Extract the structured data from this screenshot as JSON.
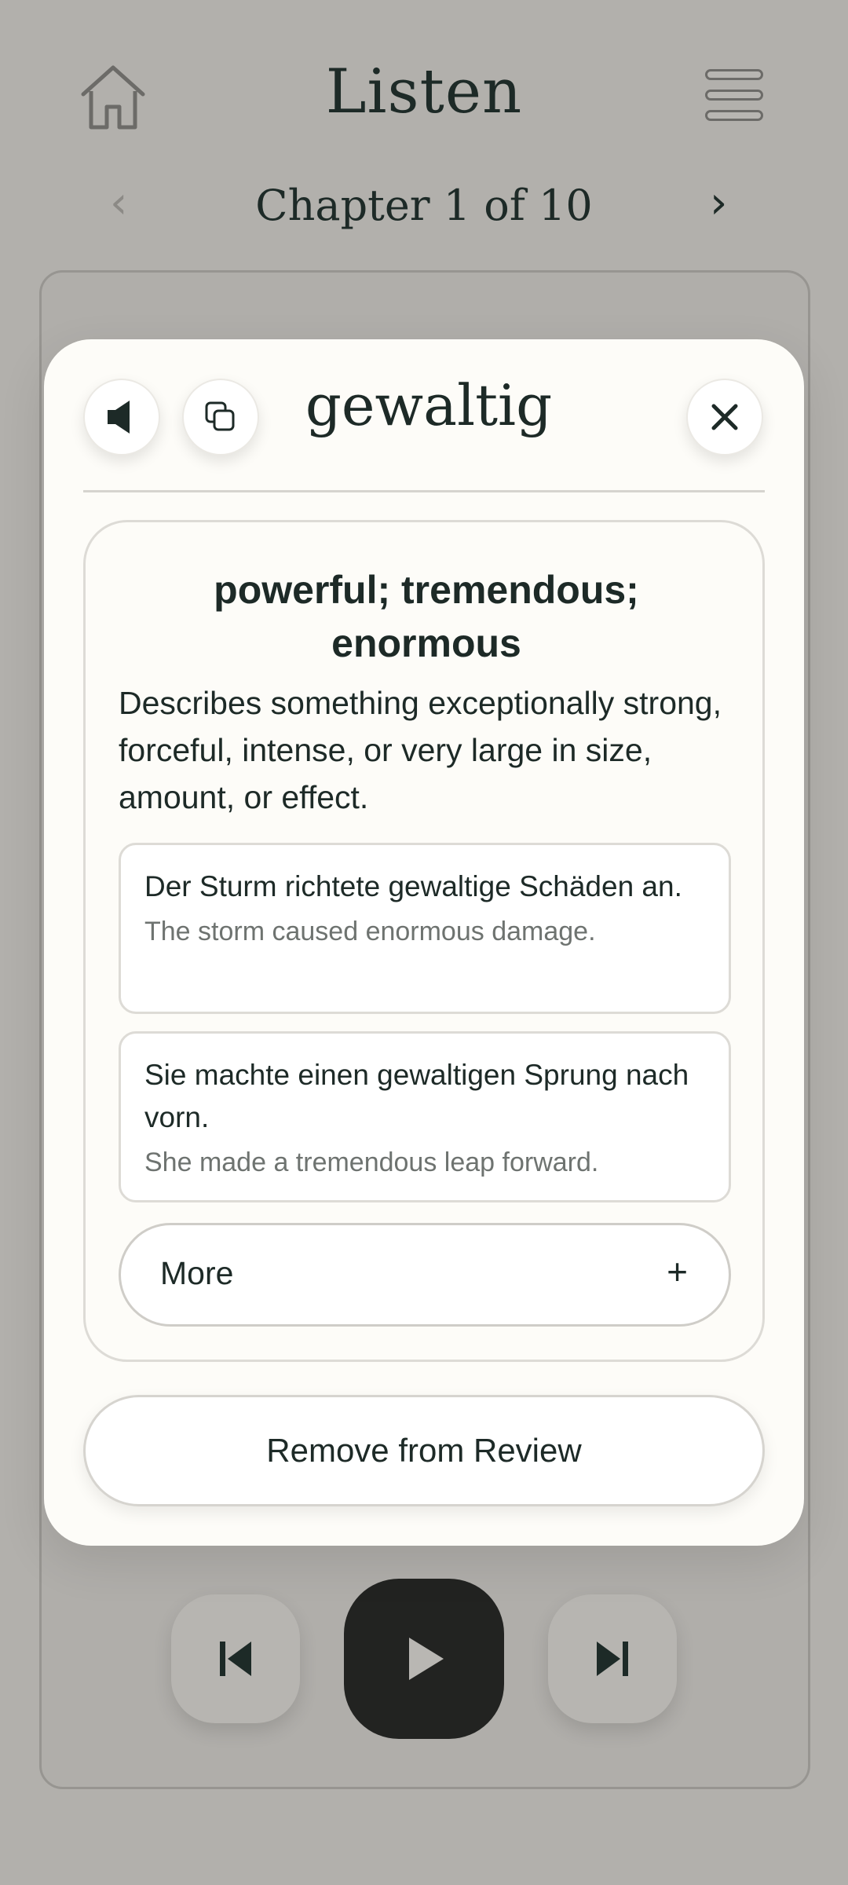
{
  "header": {
    "title": "Listen",
    "home_icon": "home-icon",
    "menu_icon": "menu-icon"
  },
  "chapter_nav": {
    "label": "Chapter 1 of 10",
    "prev_glyph": "‹",
    "next_glyph": "›"
  },
  "player": {
    "prev_icon": "skip-previous-icon",
    "play_icon": "play-icon",
    "next_icon": "skip-next-icon"
  },
  "popup": {
    "word": "gewaltig",
    "audio_icon": "speaker-icon",
    "copy_icon": "copy-icon",
    "close_icon": "close-icon",
    "translation": "powerful; tremendous; enormous",
    "description": "Describes something exceptionally strong, forceful, intense, or very large in size, amount, or effect.",
    "examples": [
      {
        "german": "Der Sturm richtete gewaltige Schäden an.",
        "english": "The storm caused enormous damage."
      },
      {
        "german": "Sie machte einen gewaltigen Sprung nach vorn.",
        "english": "She made a tremendous leap forward."
      }
    ],
    "more_label": "More",
    "more_glyph": "+",
    "remove_label": "Remove from Review"
  },
  "colors": {
    "backdrop": "#b2b0ac",
    "modal_bg": "#fdfcf8",
    "text": "#1d2a27",
    "muted_text": "#6e7370",
    "play_button": "#222321"
  }
}
